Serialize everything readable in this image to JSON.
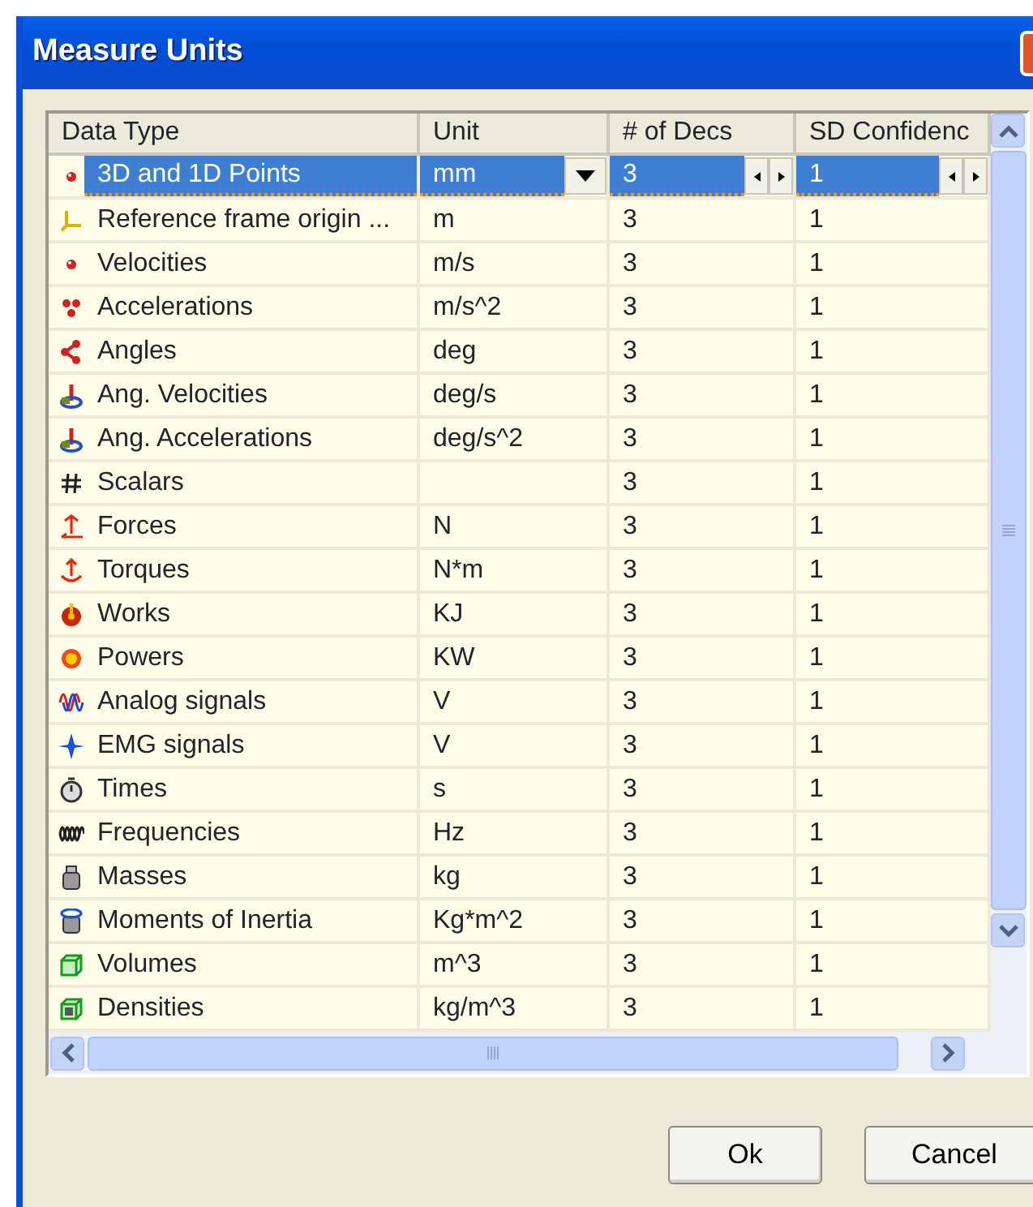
{
  "window": {
    "title": "Measure Units"
  },
  "table": {
    "columns": [
      "Data Type",
      "Unit",
      "# of Decs",
      "SD Confidenc"
    ],
    "rows": [
      {
        "data_type": "3D and 1D Points",
        "unit": "mm",
        "decimals": "3",
        "sd_confidence": "1",
        "selected": true
      },
      {
        "data_type": "Reference frame origin ...",
        "unit": "m",
        "decimals": "3",
        "sd_confidence": "1",
        "selected": false
      },
      {
        "data_type": "Velocities",
        "unit": "m/s",
        "decimals": "3",
        "sd_confidence": "1",
        "selected": false
      },
      {
        "data_type": "Accelerations",
        "unit": "m/s^2",
        "decimals": "3",
        "sd_confidence": "1",
        "selected": false
      },
      {
        "data_type": "Angles",
        "unit": "deg",
        "decimals": "3",
        "sd_confidence": "1",
        "selected": false
      },
      {
        "data_type": "Ang. Velocities",
        "unit": "deg/s",
        "decimals": "3",
        "sd_confidence": "1",
        "selected": false
      },
      {
        "data_type": "Ang. Accelerations",
        "unit": "deg/s^2",
        "decimals": "3",
        "sd_confidence": "1",
        "selected": false
      },
      {
        "data_type": "Scalars",
        "decimals": "3",
        "sd_confidence": "1",
        "selected": false
      },
      {
        "data_type": "Forces",
        "unit": "N",
        "decimals": "3",
        "sd_confidence": "1",
        "selected": false
      },
      {
        "data_type": "Torques",
        "unit": "N*m",
        "decimals": "3",
        "sd_confidence": "1",
        "selected": false
      },
      {
        "data_type": "Works",
        "unit": "KJ",
        "decimals": "3",
        "sd_confidence": "1",
        "selected": false
      },
      {
        "data_type": "Powers",
        "unit": "KW",
        "decimals": "3",
        "sd_confidence": "1",
        "selected": false
      },
      {
        "data_type": "Analog signals",
        "unit": "V",
        "decimals": "3",
        "sd_confidence": "1",
        "selected": false
      },
      {
        "data_type": "EMG signals",
        "unit": "V",
        "decimals": "3",
        "sd_confidence": "1",
        "selected": false
      },
      {
        "data_type": "Times",
        "unit": "s",
        "decimals": "3",
        "sd_confidence": "1",
        "selected": false
      },
      {
        "data_type": "Frequencies",
        "unit": "Hz",
        "decimals": "3",
        "sd_confidence": "1",
        "selected": false
      },
      {
        "data_type": "Masses",
        "unit": "kg",
        "decimals": "3",
        "sd_confidence": "1",
        "selected": false
      },
      {
        "data_type": "Moments of Inertia",
        "unit": "Kg*m^2",
        "decimals": "3",
        "sd_confidence": "1",
        "selected": false
      },
      {
        "data_type": "Volumes",
        "unit": "m^3",
        "decimals": "3",
        "sd_confidence": "1",
        "selected": false
      },
      {
        "data_type": "Densities",
        "unit": "kg/m^3",
        "decimals": "3",
        "sd_confidence": "1",
        "selected": false
      }
    ]
  },
  "buttons": [
    "Ok",
    "Cancel"
  ]
}
